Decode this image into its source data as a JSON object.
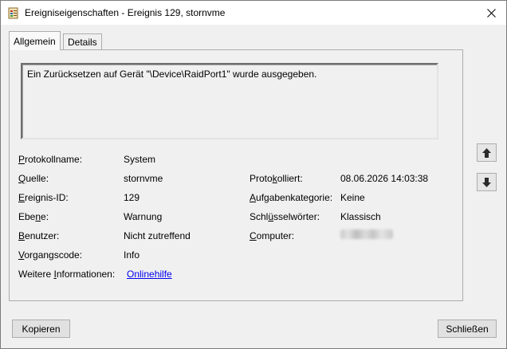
{
  "window": {
    "title": "Ereigniseigenschaften - Ereignis 129, stornvme"
  },
  "tabs": [
    {
      "label": "Allgemein",
      "active": true
    },
    {
      "label": "Details",
      "active": false
    }
  ],
  "description": "Ein Zurücksetzen auf Gerät \"\\Device\\RaidPort1\" wurde ausgegeben.",
  "fields": {
    "protokollname": {
      "label": "Protokollname:",
      "value": "System"
    },
    "quelle": {
      "label": "Quelle:",
      "value": "stornvme"
    },
    "ereignis_id": {
      "label": "Ereignis-ID:",
      "value": "129"
    },
    "ebene": {
      "label": "Ebene:",
      "value": "Warnung"
    },
    "benutzer": {
      "label": "Benutzer:",
      "value": "Nicht zutreffend"
    },
    "vorgangscode": {
      "label": "Vorgangscode:",
      "value": "Info"
    },
    "weitere_info": {
      "label": "Weitere Informationen:",
      "value": "Onlinehilfe"
    },
    "protokolliert": {
      "label": "Protokolliert:",
      "value": "08.06.2026 14:03:38"
    },
    "aufgabenkategorie": {
      "label": "Aufgabenkategorie:",
      "value": "Keine"
    },
    "schluesselwoerter": {
      "label": "Schlüsselwörter:",
      "value": "Klassisch"
    },
    "computer": {
      "label": "Computer:"
    }
  },
  "buttons": {
    "copy": "Kopieren",
    "close": "Schließen"
  },
  "icons": {
    "title": "event-properties-icon",
    "close": "close-icon",
    "up": "arrow-up-icon",
    "down": "arrow-down-icon"
  },
  "colors": {
    "link": "#0000ee",
    "background": "#f0f0f0"
  }
}
